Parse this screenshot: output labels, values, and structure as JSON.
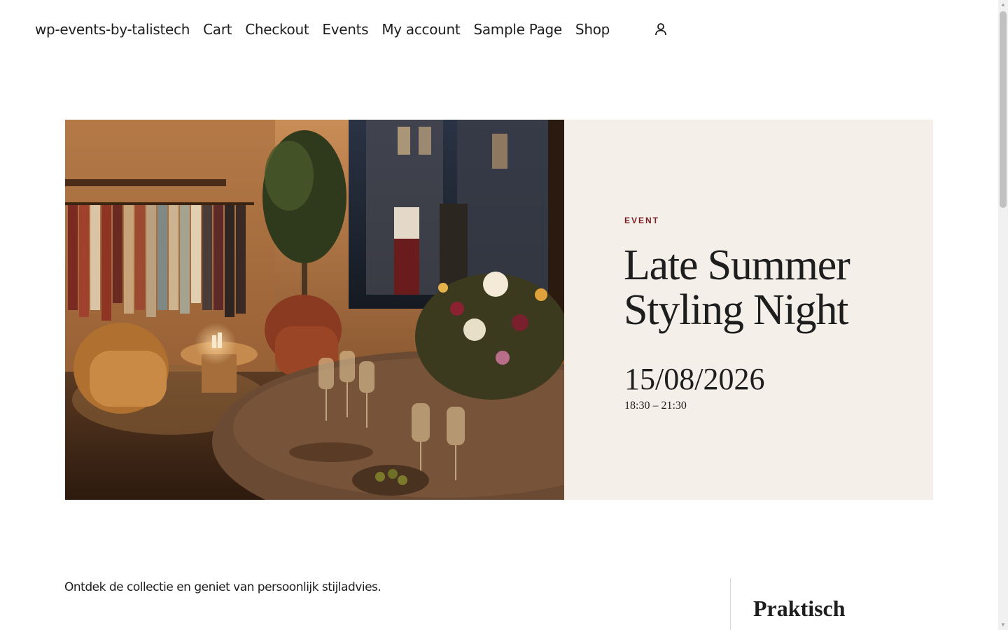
{
  "nav": {
    "site_title": "wp-events-by-talistech",
    "items": [
      {
        "label": "Cart"
      },
      {
        "label": "Checkout"
      },
      {
        "label": "Events"
      },
      {
        "label": "My account"
      },
      {
        "label": "Sample Page"
      },
      {
        "label": "Shop"
      }
    ],
    "account_icon": "user-icon"
  },
  "hero": {
    "image_desc": "boutique-interior-evening-event-photo",
    "eyebrow": "EVENT",
    "title": "Late Summer Styling Night",
    "date": "15/08/2026",
    "time": "18:30 – 21:30"
  },
  "content": {
    "intro": "Ontdek de collectie en geniet van persoonlijk stijladvies.",
    "sidebar_title": "Praktisch"
  },
  "colors": {
    "accent": "#7a1f24",
    "panel_bg": "#f5efe9",
    "text": "#1e1e1e"
  }
}
